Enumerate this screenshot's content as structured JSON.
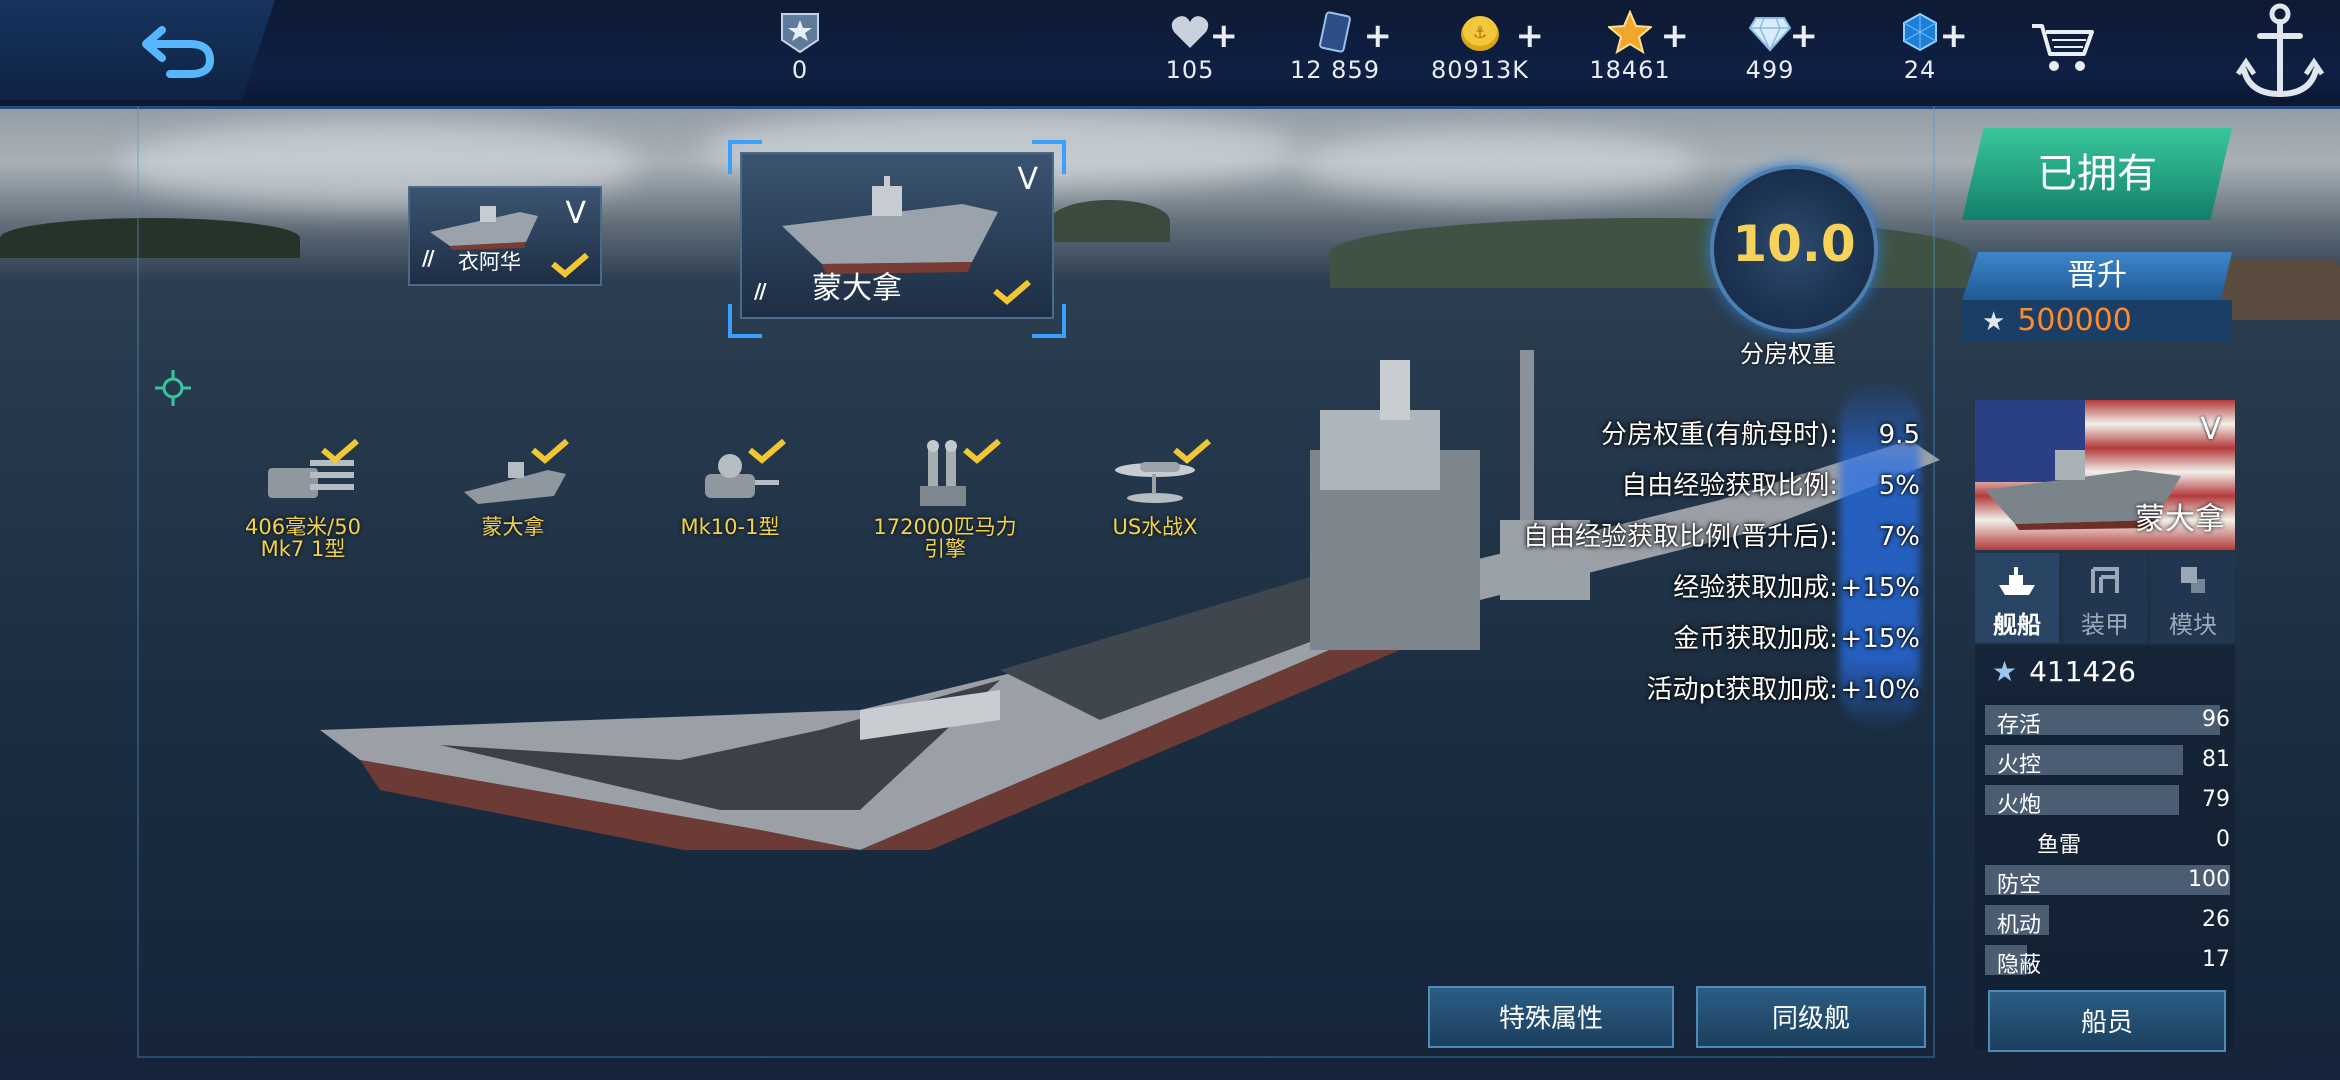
{
  "topbar": {
    "resources": [
      {
        "icon": "rank-badge-icon",
        "value": "0",
        "plus": ""
      },
      {
        "icon": "heart-icon",
        "value": "105",
        "plus": "+"
      },
      {
        "icon": "card-icon",
        "value": "12 859",
        "plus": "+"
      },
      {
        "icon": "gold-coin-icon",
        "value": "80913K",
        "plus": "+"
      },
      {
        "icon": "gold-star-icon",
        "value": "18461",
        "plus": "+"
      },
      {
        "icon": "diamond-icon",
        "value": "499",
        "plus": "+"
      },
      {
        "icon": "blue-gem-icon",
        "value": "24",
        "plus": "+"
      }
    ]
  },
  "ship_cards": [
    {
      "name": "衣阿华",
      "tier": "V",
      "navy_mark": "//",
      "selected": false
    },
    {
      "name": "蒙大拿",
      "tier": "V",
      "navy_mark": "//",
      "selected": true
    }
  ],
  "modules": [
    {
      "label_line1": "406毫米/50",
      "label_line2": "Mk7 1型",
      "icon": "turret-icon"
    },
    {
      "label_line1": "蒙大拿",
      "label_line2": "",
      "icon": "hull-icon"
    },
    {
      "label_line1": "Mk10-1型",
      "label_line2": "",
      "icon": "fire-control-icon"
    },
    {
      "label_line1": "172000匹马力",
      "label_line2": "引擎",
      "icon": "engine-icon"
    },
    {
      "label_line1": "US水战X",
      "label_line2": "",
      "icon": "seaplane-icon"
    }
  ],
  "rating": {
    "value": "10.0",
    "label": "分房权重"
  },
  "stats": [
    {
      "label": "分房权重(有航母时):",
      "value": "9.5"
    },
    {
      "label": "自由经验获取比例:",
      "value": "5%"
    },
    {
      "label": "自由经验获取比例(晋升后):",
      "value": "7%"
    },
    {
      "label": "经验获取加成:",
      "value": "+15%"
    },
    {
      "label": "金币获取加成:",
      "value": "+15%"
    },
    {
      "label": "活动pt获取加成:",
      "value": "+10%"
    }
  ],
  "right_panel": {
    "owned_label": "已拥有",
    "promote_label": "晋升",
    "promote_cost": "500000",
    "portrait_tier": "V",
    "portrait_name": "蒙大拿",
    "tabs": [
      {
        "label": "舰船",
        "icon": "ship-tab-icon",
        "active": true
      },
      {
        "label": "装甲",
        "icon": "armor-tab-icon",
        "active": false
      },
      {
        "label": "模块",
        "icon": "module-tab-icon",
        "active": false
      }
    ],
    "score": "411426",
    "attributes": [
      {
        "label": "存活",
        "value": "96",
        "fraction": 0.96
      },
      {
        "label": "火控",
        "value": "81",
        "fraction": 0.81
      },
      {
        "label": "火炮",
        "value": "79",
        "fraction": 0.79
      },
      {
        "label": "鱼雷",
        "value": "0",
        "fraction": 0.0
      },
      {
        "label": "防空",
        "value": "100",
        "fraction": 1.0
      },
      {
        "label": "机动",
        "value": "26",
        "fraction": 0.26
      },
      {
        "label": "隐蔽",
        "value": "17",
        "fraction": 0.17
      }
    ],
    "crew_button": "船员"
  },
  "bottom_buttons": {
    "special": "特殊属性",
    "same_tier": "同级舰"
  },
  "colors": {
    "accent_gold": "#f2d24a",
    "owned_green": "#2aa985",
    "promote_blue": "#2f6fae",
    "cost_orange": "#ff8a2a"
  }
}
